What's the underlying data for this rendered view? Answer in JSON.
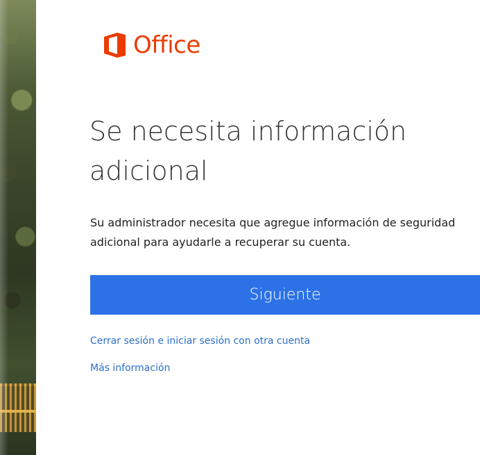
{
  "brand": {
    "name": "Office",
    "icon": "office-logo-icon",
    "color": "#eb3c00"
  },
  "page": {
    "title": "Se necesita información adicional",
    "description": "Su administrador necesita que agregue información de seguridad adicional para ayudarle a recuperar su cuenta."
  },
  "actions": {
    "next_label": "Siguiente",
    "next_color": "#2c72e6",
    "signout_link": "Cerrar sesión e iniciar sesión con otra cuenta",
    "more_info_link": "Más información",
    "link_color": "#2b6fc7"
  }
}
